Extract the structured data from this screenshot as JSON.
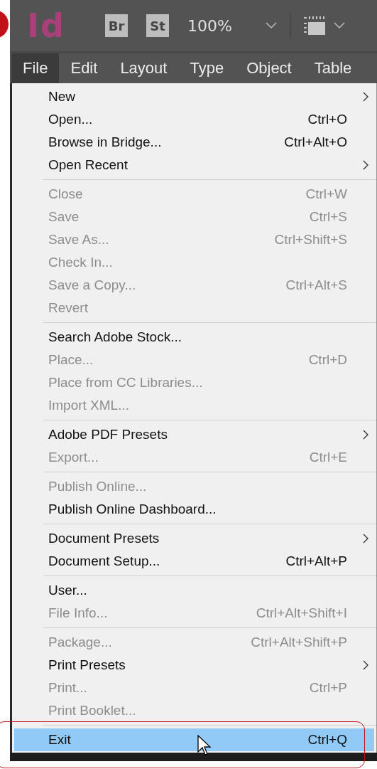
{
  "top_bar": {
    "app_logo": "Id",
    "bridge_button": "Br",
    "stock_button": "St",
    "zoom": "100%"
  },
  "menu_bar": [
    {
      "label": "File",
      "selected": true
    },
    {
      "label": "Edit",
      "selected": false
    },
    {
      "label": "Layout",
      "selected": false
    },
    {
      "label": "Type",
      "selected": false
    },
    {
      "label": "Object",
      "selected": false
    },
    {
      "label": "Table",
      "selected": false
    }
  ],
  "menu": {
    "groups": [
      {
        "items": [
          {
            "label": "New",
            "submenu": true,
            "disabled": false,
            "selected": false
          },
          {
            "label": "Open...",
            "shortcut": "Ctrl+O",
            "submenu": false,
            "disabled": false,
            "selected": false
          },
          {
            "label": "Browse in Bridge...",
            "shortcut": "Ctrl+Alt+O",
            "submenu": false,
            "disabled": false,
            "selected": false
          },
          {
            "label": "Open Recent",
            "submenu": true,
            "disabled": false,
            "selected": false
          }
        ]
      },
      {
        "items": [
          {
            "label": "Close",
            "shortcut": "Ctrl+W",
            "submenu": false,
            "disabled": true,
            "selected": false
          },
          {
            "label": "Save",
            "shortcut": "Ctrl+S",
            "submenu": false,
            "disabled": true,
            "selected": false
          },
          {
            "label": "Save As...",
            "shortcut": "Ctrl+Shift+S",
            "submenu": false,
            "disabled": true,
            "selected": false
          },
          {
            "label": "Check In...",
            "submenu": false,
            "disabled": true,
            "selected": false
          },
          {
            "label": "Save a Copy...",
            "shortcut": "Ctrl+Alt+S",
            "submenu": false,
            "disabled": true,
            "selected": false
          },
          {
            "label": "Revert",
            "submenu": false,
            "disabled": true,
            "selected": false
          }
        ]
      },
      {
        "items": [
          {
            "label": "Search Adobe Stock...",
            "submenu": false,
            "disabled": false,
            "selected": false
          },
          {
            "label": "Place...",
            "shortcut": "Ctrl+D",
            "submenu": false,
            "disabled": true,
            "selected": false
          },
          {
            "label": "Place from CC Libraries...",
            "submenu": false,
            "disabled": true,
            "selected": false
          },
          {
            "label": "Import XML...",
            "submenu": false,
            "disabled": true,
            "selected": false
          }
        ]
      },
      {
        "items": [
          {
            "label": "Adobe PDF Presets",
            "submenu": true,
            "disabled": false,
            "selected": false
          },
          {
            "label": "Export...",
            "shortcut": "Ctrl+E",
            "submenu": false,
            "disabled": true,
            "selected": false
          }
        ]
      },
      {
        "items": [
          {
            "label": "Publish Online...",
            "submenu": false,
            "disabled": true,
            "selected": false
          },
          {
            "label": "Publish Online Dashboard...",
            "submenu": false,
            "disabled": false,
            "selected": false
          }
        ]
      },
      {
        "items": [
          {
            "label": "Document Presets",
            "submenu": true,
            "disabled": false,
            "selected": false
          },
          {
            "label": "Document Setup...",
            "shortcut": "Ctrl+Alt+P",
            "submenu": false,
            "disabled": false,
            "selected": false
          }
        ]
      },
      {
        "items": [
          {
            "label": "User...",
            "submenu": false,
            "disabled": false,
            "selected": false
          },
          {
            "label": "File Info...",
            "shortcut": "Ctrl+Alt+Shift+I",
            "submenu": false,
            "disabled": true,
            "selected": false
          }
        ]
      },
      {
        "items": [
          {
            "label": "Package...",
            "shortcut": "Ctrl+Alt+Shift+P",
            "submenu": false,
            "disabled": true,
            "selected": false
          },
          {
            "label": "Print Presets",
            "submenu": true,
            "disabled": false,
            "selected": false
          },
          {
            "label": "Print...",
            "shortcut": "Ctrl+P",
            "submenu": false,
            "disabled": true,
            "selected": false
          },
          {
            "label": "Print Booklet...",
            "submenu": false,
            "disabled": true,
            "selected": false
          }
        ]
      },
      {
        "items": [
          {
            "label": "Exit",
            "shortcut": "Ctrl+Q",
            "submenu": false,
            "disabled": false,
            "selected": true
          }
        ]
      }
    ]
  }
}
